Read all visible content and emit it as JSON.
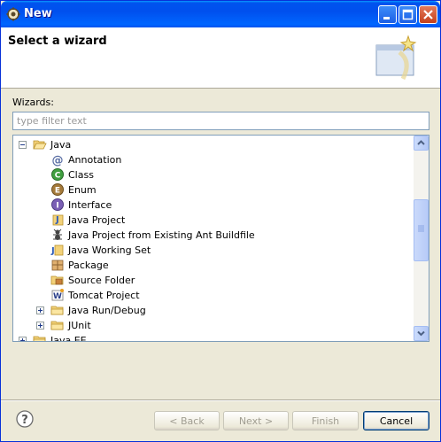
{
  "window": {
    "title": "New",
    "controls": {
      "minimize": "minimize-icon",
      "maximize": "maximize-icon",
      "close": "close-icon"
    }
  },
  "header": {
    "title": "Select a wizard",
    "graphic": "wizard-banner-icon"
  },
  "wizards_label": "Wizards:",
  "filter": {
    "placeholder": "type filter text",
    "value": ""
  },
  "tree": [
    {
      "label": "Java",
      "level": 0,
      "expander": "minus",
      "icon": "folder-open-icon"
    },
    {
      "label": "Annotation",
      "level": 1,
      "icon": "annotation-icon"
    },
    {
      "label": "Class",
      "level": 1,
      "icon": "class-icon"
    },
    {
      "label": "Enum",
      "level": 1,
      "icon": "enum-icon"
    },
    {
      "label": "Interface",
      "level": 1,
      "icon": "interface-icon"
    },
    {
      "label": "Java Project",
      "level": 1,
      "icon": "java-project-icon"
    },
    {
      "label": "Java Project from Existing Ant Buildfile",
      "level": 1,
      "icon": "ant-icon"
    },
    {
      "label": "Java Working Set",
      "level": 1,
      "icon": "working-set-icon"
    },
    {
      "label": "Package",
      "level": 1,
      "icon": "package-icon"
    },
    {
      "label": "Source Folder",
      "level": 1,
      "icon": "source-folder-icon"
    },
    {
      "label": "Tomcat Project",
      "level": 1,
      "icon": "tomcat-icon"
    },
    {
      "label": "Java Run/Debug",
      "level": 1,
      "expander": "plus",
      "icon": "folder-icon"
    },
    {
      "label": "JUnit",
      "level": 1,
      "expander": "plus",
      "icon": "folder-icon"
    },
    {
      "label": "Java EE",
      "level": 0,
      "expander": "plus",
      "icon": "folder-icon"
    }
  ],
  "buttons": {
    "back": "< Back",
    "next": "Next >",
    "finish": "Finish",
    "cancel": "Cancel"
  },
  "help_icon": "help-icon",
  "colors": {
    "titlebar": "#0053ee",
    "dialog_bg": "#ece9d8",
    "border": "#7f9db9"
  }
}
